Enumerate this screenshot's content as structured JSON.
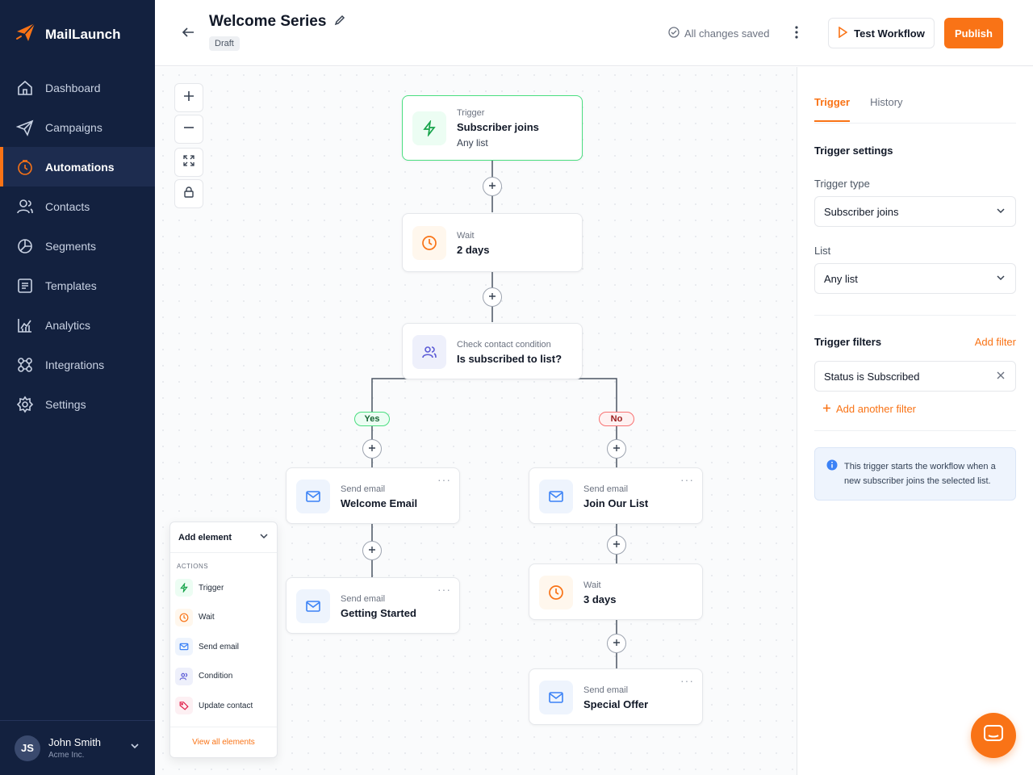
{
  "brand": {
    "name": "MailLaunch",
    "accent": "#f97316",
    "sidebar_bg": "#13213f"
  },
  "sidebar": {
    "items": [
      {
        "label": "Dashboard",
        "icon": "home-icon"
      },
      {
        "label": "Campaigns",
        "icon": "send-icon"
      },
      {
        "label": "Automations",
        "icon": "automation-icon",
        "active": true
      },
      {
        "label": "Contacts",
        "icon": "contacts-icon"
      },
      {
        "label": "Segments",
        "icon": "segments-icon"
      },
      {
        "label": "Templates",
        "icon": "templates-icon"
      },
      {
        "label": "Analytics",
        "icon": "analytics-icon"
      },
      {
        "label": "Integrations",
        "icon": "integrations-icon"
      },
      {
        "label": "Settings",
        "icon": "gear-icon"
      }
    ],
    "user": {
      "initials": "JS",
      "name": "John Smith",
      "org": "Acme Inc."
    }
  },
  "header": {
    "title": "Welcome Series",
    "status": "Draft",
    "saved": "All changes saved",
    "test_label": "Test Workflow",
    "publish_label": "Publish"
  },
  "workflow": {
    "trigger": {
      "label": "Trigger",
      "value": "Subscriber joins",
      "sub": "Any list"
    },
    "wait1": {
      "label": "Wait",
      "value": "2 days"
    },
    "condition": {
      "label": "Check contact condition",
      "value": "Is subscribed to list?"
    },
    "yes_label": "Yes",
    "no_label": "No",
    "yes_email1": {
      "label": "Send email",
      "value": "Welcome Email"
    },
    "yes_email2": {
      "label": "Send email",
      "value": "Getting Started"
    },
    "no_email1": {
      "label": "Send email",
      "value": "Join Our List"
    },
    "no_wait": {
      "label": "Wait",
      "value": "3 days"
    },
    "no_email2": {
      "label": "Send email",
      "value": "Special Offer"
    }
  },
  "add_panel": {
    "title": "Add element",
    "section": "ACTIONS",
    "items": [
      {
        "label": "Trigger",
        "icon": "bolt-icon"
      },
      {
        "label": "Wait",
        "icon": "clock-icon"
      },
      {
        "label": "Send email",
        "icon": "mail-icon"
      },
      {
        "label": "Condition",
        "icon": "users-icon"
      },
      {
        "label": "Update contact",
        "icon": "tag-icon"
      }
    ],
    "view_all": "View all elements"
  },
  "right_panel": {
    "tabs": [
      "Trigger",
      "History"
    ],
    "settings_title": "Trigger settings",
    "trigger_type_label": "Trigger type",
    "trigger_type_value": "Subscriber joins",
    "list_label": "List",
    "list_value": "Any list",
    "filters_title": "Trigger filters",
    "add_filter": "Add filter",
    "filter_chip": "Status is Subscribed",
    "add_another": "Add another filter",
    "info_text": "This trigger starts the workflow when a new subscriber joins the selected list."
  }
}
